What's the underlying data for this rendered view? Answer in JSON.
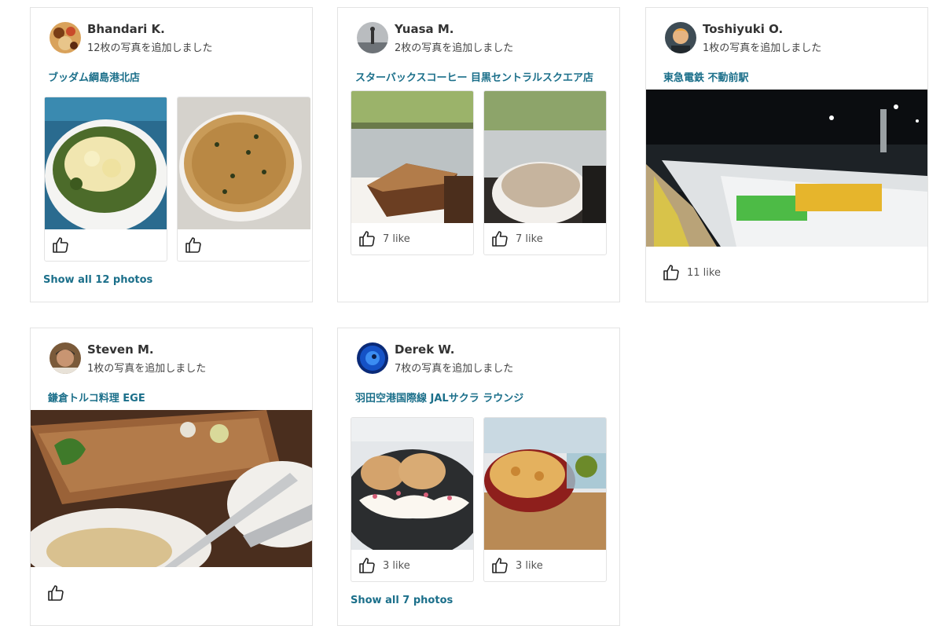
{
  "cards": [
    {
      "user": "Bhandari K.",
      "subtitle": "12枚の写真を追加しました",
      "place": "ブッダム綱島港北店",
      "photos": [
        {
          "like_count": ""
        },
        {
          "like_count": ""
        }
      ],
      "show_all": "Show all 12 photos"
    },
    {
      "user": "Yuasa M.",
      "subtitle": "2枚の写真を追加しました",
      "place": "スターバックスコーヒー 目黒セントラルスクエア店",
      "photos": [
        {
          "like_count": "7 like"
        },
        {
          "like_count": "7 like"
        }
      ]
    },
    {
      "user": "Toshiyuki O.",
      "subtitle": "1枚の写真を追加しました",
      "place": "東急電鉄 不動前駅",
      "photos": [
        {
          "like_count": "11 like"
        }
      ]
    },
    {
      "user": "Steven M.",
      "subtitle": "1枚の写真を追加しました",
      "place": "鎌倉トルコ料理 EGE",
      "photos": [
        {
          "like_count": ""
        }
      ]
    },
    {
      "user": "Derek W.",
      "subtitle": "7枚の写真を追加しました",
      "place": "羽田空港国際線 JALサクラ ラウンジ",
      "photos": [
        {
          "like_count": "3 like"
        },
        {
          "like_count": "3 like"
        }
      ],
      "show_all": "Show all 7 photos"
    }
  ],
  "icons": {
    "like": "thumbs-up-icon"
  },
  "colors": {
    "link": "#1b6f8a",
    "border": "#e3e3e3"
  }
}
